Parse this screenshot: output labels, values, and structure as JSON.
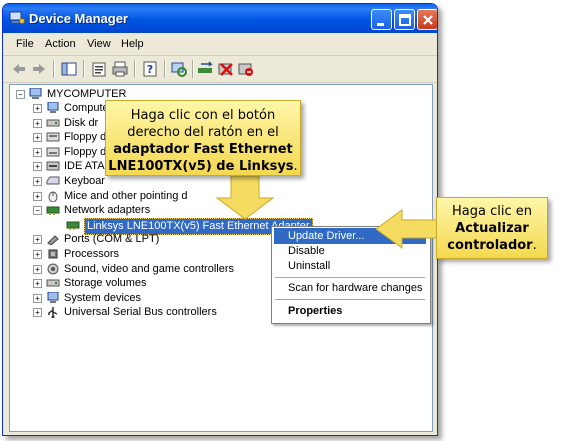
{
  "window": {
    "title": "Device Manager"
  },
  "menu": [
    "File",
    "Action",
    "View",
    "Help"
  ],
  "tree": {
    "root": "MYCOMPUTER",
    "items": [
      {
        "label": "Computer",
        "icon": "computer-icon"
      },
      {
        "label": "Disk dr",
        "icon": "disk-drive-icon"
      },
      {
        "label": "Floppy d",
        "icon": "floppy-controller-icon"
      },
      {
        "label": "Floppy d",
        "icon": "floppy-drive-icon"
      },
      {
        "label": "IDE ATA",
        "icon": "ide-controller-icon"
      },
      {
        "label": "Keyboar",
        "icon": "keyboard-icon"
      },
      {
        "label": "Mice and other pointing d",
        "icon": "mouse-icon"
      },
      {
        "label": "Network adapters",
        "icon": "network-adapter-icon"
      },
      {
        "label": "Linksys LNE100TX(v5) Fast Ethernet Adapter",
        "icon": "network-card-icon"
      },
      {
        "label": "Ports (COM & LPT)",
        "icon": "port-icon"
      },
      {
        "label": "Processors",
        "icon": "processor-icon"
      },
      {
        "label": "Sound, video and game controllers",
        "icon": "sound-icon"
      },
      {
        "label": "Storage volumes",
        "icon": "storage-icon"
      },
      {
        "label": "System devices",
        "icon": "system-devices-icon"
      },
      {
        "label": "Universal Serial Bus controllers",
        "icon": "usb-icon"
      }
    ]
  },
  "context_menu": {
    "update_driver": "Update Driver...",
    "disable": "Disable",
    "uninstall": "Uninstall",
    "scan": "Scan for hardware changes",
    "properties": "Properties"
  },
  "callouts": {
    "left": {
      "line1": "Haga clic con el botón",
      "line2": "derecho del ratón en el",
      "line3": "adaptador Fast Ethernet",
      "line4": "LNE100TX(v5) de Linksys",
      "line4_end": "."
    },
    "right": {
      "line1": "Haga clic en",
      "line2": "Actualizar",
      "line3": "controlador",
      "line3_end": "."
    }
  },
  "colors": {
    "callout_fill": "#f7e27a",
    "selection": "#316ac5",
    "titlebar": "#0054e3"
  }
}
